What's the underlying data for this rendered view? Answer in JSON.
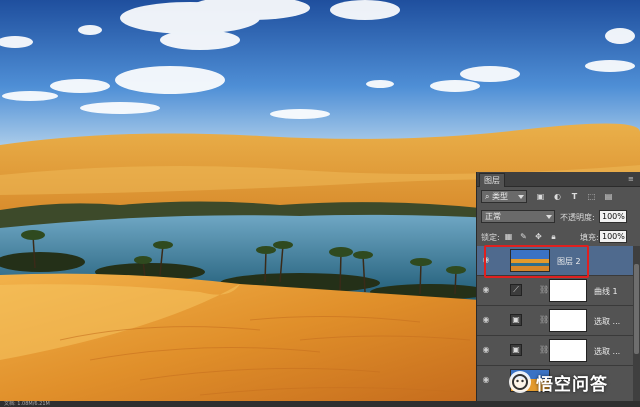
{
  "panel": {
    "tab_label": "图层",
    "filter": {
      "selected": "类型",
      "icons": [
        "image-filter-icon",
        "adjustment-filter-icon",
        "type-filter-icon",
        "shape-filter-icon",
        "smart-object-filter-icon"
      ]
    },
    "blend_mode": "正常",
    "opacity_label": "不透明度:",
    "opacity_value": "100%",
    "lock_label": "锁定:",
    "fill_label": "填充:",
    "fill_value": "100%",
    "layers": [
      {
        "name": "图层 2",
        "type": "image",
        "selected": true
      },
      {
        "name": "曲线 1",
        "type": "curves",
        "selected": false
      },
      {
        "name": "选取 ...",
        "type": "selective-color",
        "selected": false
      },
      {
        "name": "选取 ...",
        "type": "selective-color",
        "selected": false
      },
      {
        "name": "",
        "type": "background",
        "selected": false
      }
    ]
  },
  "watermark": {
    "text": "悟空问答"
  },
  "status": {
    "text": "文档: 1.08M/6.21M"
  },
  "colors": {
    "panel_bg": "#535353",
    "selected_layer": "#4f6a8e",
    "highlight": "#e0201f",
    "sky": "#3a72c4",
    "sand": "#e39a2c",
    "water": "#2f6d8a"
  }
}
